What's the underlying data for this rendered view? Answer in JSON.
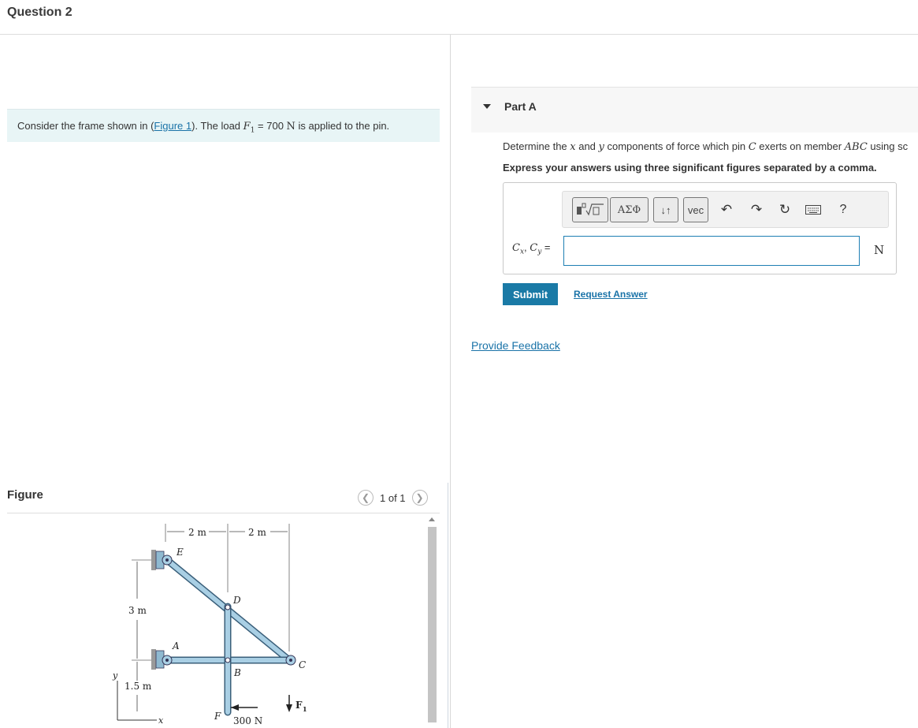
{
  "question": {
    "title": "Question 2"
  },
  "intro": {
    "text_before": "Consider the frame shown in (",
    "figure_link": "Figure 1",
    "text_mid": "). The load ",
    "symbol": "F",
    "subscript": "1",
    "value": " = 700 ",
    "unit": "N",
    "text_after": " is applied to the pin."
  },
  "figure": {
    "label": "Figure",
    "pager": "1 of 1",
    "prev_icon": "chevron-left-icon",
    "next_icon": "chevron-right-icon",
    "labels": {
      "dim_top_left": "2 m",
      "dim_top_right": "2 m",
      "dim_left_1": "3 m",
      "dim_left_2": "1.5 m",
      "E": "E",
      "D": "D",
      "A": "A",
      "B": "B",
      "C": "C",
      "F": "F",
      "y": "y",
      "x": "x",
      "force_300": "300 N",
      "F1": "F",
      "F1_sub": "1"
    }
  },
  "part_a": {
    "label": "Part A",
    "prompt_parts": {
      "p1": "Determine the ",
      "x": "x",
      "p2": " and ",
      "y": "y",
      "p3": " components of force which pin ",
      "C": "C",
      "p4": " exerts on member ",
      "ABC": "ABC",
      "p5": " using sc"
    },
    "instructions": "Express your answers using three significant figures separated by a comma.",
    "toolbar": {
      "templates_icon": "templates-icon",
      "greek_label": "ΑΣΦ",
      "arrows_label": "↓↑",
      "vec_label": "vec",
      "undo_icon": "undo-icon",
      "redo_icon": "redo-icon",
      "reset_icon": "reset-icon",
      "keyboard_icon": "keyboard-icon",
      "help_label": "?"
    },
    "answer": {
      "label_Cx": "C",
      "sub_x": "x",
      "comma": ", ",
      "label_Cy": "C",
      "sub_y": "y",
      "eq": " =",
      "value": "",
      "unit": "N"
    },
    "submit_label": "Submit",
    "request_label": "Request Answer"
  },
  "feedback_label": "Provide Feedback"
}
